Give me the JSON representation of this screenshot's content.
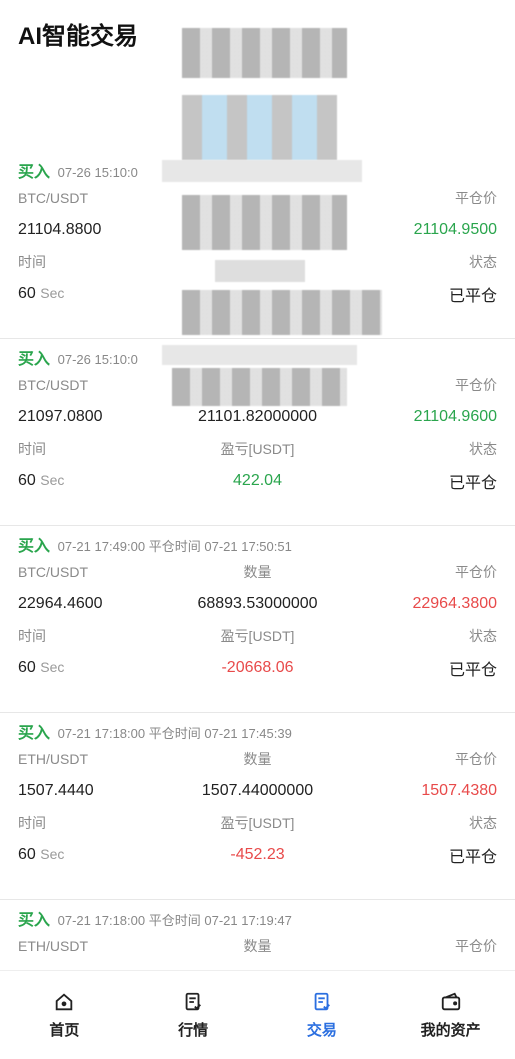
{
  "header": {
    "title": "AI智能交易"
  },
  "labels": {
    "close_price": "平仓价",
    "time": "时间",
    "status": "状态",
    "quantity": "数量",
    "pnl": "盈亏[USDT]",
    "sec": "Sec",
    "close_time_prefix": "平仓时间"
  },
  "orders": [
    {
      "side": "买入",
      "open_time": "07-26 15:10:0",
      "close_time": "",
      "pair": "BTC/USDT",
      "open_price": "21104.8800",
      "quantity": "",
      "close_price": "21104.9500",
      "duration": "60",
      "pnl": "",
      "status": "已平仓"
    },
    {
      "side": "买入",
      "open_time": "07-26 15:10:0",
      "close_time": "",
      "pair": "BTC/USDT",
      "open_price": "21097.0800",
      "quantity": "21101.82000000",
      "close_price": "21104.9600",
      "duration": "60",
      "pnl": "422.04",
      "status": "已平仓"
    },
    {
      "side": "买入",
      "open_time": "07-21 17:49:00",
      "close_time": "07-21 17:50:51",
      "pair": "BTC/USDT",
      "open_price": "22964.4600",
      "quantity": "68893.53000000",
      "close_price": "22964.3800",
      "duration": "60",
      "pnl": "-20668.06",
      "status": "已平仓"
    },
    {
      "side": "买入",
      "open_time": "07-21 17:18:00",
      "close_time": "07-21 17:45:39",
      "pair": "ETH/USDT",
      "open_price": "1507.4440",
      "quantity": "1507.44000000",
      "close_price": "1507.4380",
      "duration": "60",
      "pnl": "-452.23",
      "status": "已平仓"
    },
    {
      "side": "买入",
      "open_time": "07-21 17:18:00",
      "close_time": "07-21 17:19:47",
      "pair": "ETH/USDT",
      "quantity_label": "数量",
      "close_price_label": "平仓价"
    }
  ],
  "tabbar": {
    "items": [
      {
        "label": "首页",
        "icon": "home-icon"
      },
      {
        "label": "行情",
        "icon": "market-icon"
      },
      {
        "label": "交易",
        "icon": "trade-icon",
        "active": true
      },
      {
        "label": "我的资产",
        "icon": "wallet-icon"
      }
    ]
  },
  "colors": {
    "buy": "#2aa54d",
    "loss": "#e84a4a",
    "active_tab": "#2b6fe0"
  }
}
